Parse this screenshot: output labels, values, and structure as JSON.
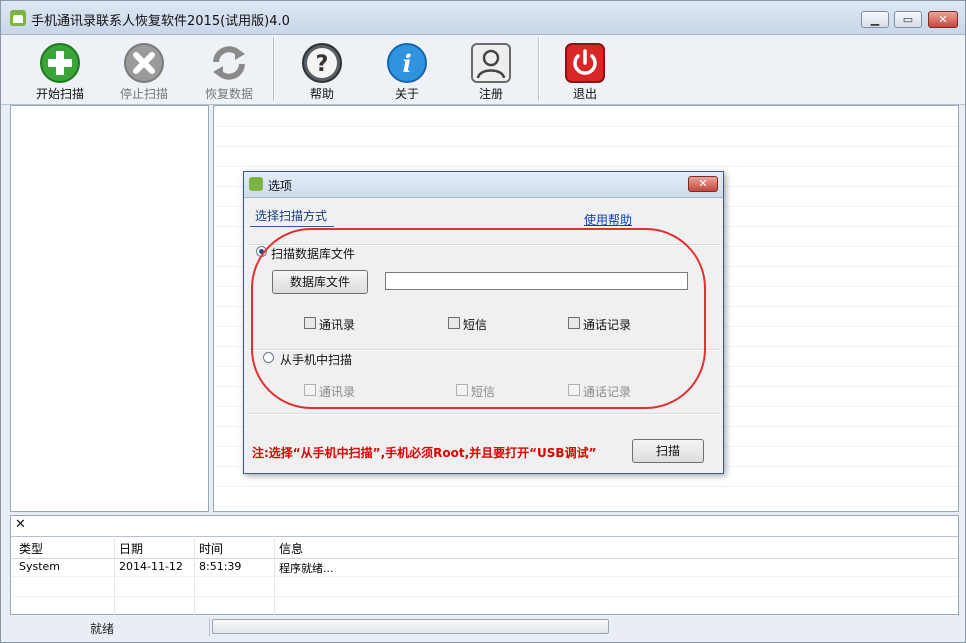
{
  "window": {
    "title": "手机通讯录联系人恢复软件2015(试用版)4.0"
  },
  "toolbar": {
    "start_scan": "开始扫描",
    "stop_scan": "停止扫描",
    "restore_data": "恢复数据",
    "help": "帮助",
    "about": "关于",
    "register": "注册",
    "exit": "退出"
  },
  "log": {
    "close_glyph": "✕",
    "headers": {
      "type": "类型",
      "date": "日期",
      "time": "时间",
      "info": "信息"
    },
    "rows": [
      {
        "type": "System",
        "date": "2014-11-12",
        "time": "8:51:39",
        "info": "程序就绪..."
      }
    ]
  },
  "status": {
    "text": "就绪",
    "progress": 0
  },
  "dialog": {
    "title": "选项",
    "tab": "选择扫描方式",
    "help_link": "使用帮助",
    "option_db": "扫描数据库文件",
    "db_file_button": "数据库文件",
    "db_path": "",
    "db_checks": [
      "通讯录",
      "短信",
      "通话记录"
    ],
    "option_phone": "从手机中扫描",
    "phone_checks": [
      "通讯录",
      "短信",
      "通话记录"
    ],
    "note": "注:选择“从手机中扫描”,手机必须Root,并且要打开“USB调试”",
    "scan_button": "扫描"
  },
  "colors": {
    "accent_red": "#e03030",
    "link_blue": "#0b3fc2"
  }
}
